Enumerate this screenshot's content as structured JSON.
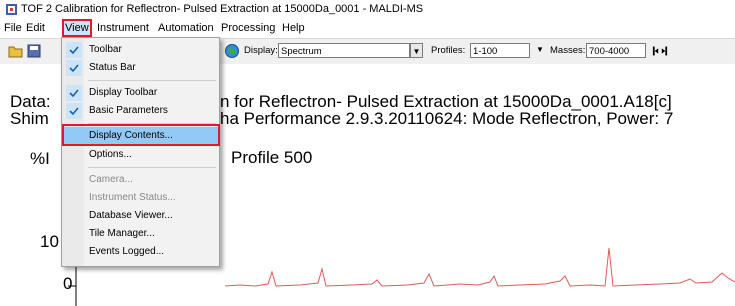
{
  "window": {
    "title": "TOF 2 Calibration for Reflectron- Pulsed Extraction at 15000Da_0001 - MALDI-MS"
  },
  "menubar": {
    "items": [
      "File",
      "Edit",
      "View",
      "Instrument",
      "Automation",
      "Processing",
      "Help"
    ],
    "open": "View"
  },
  "toolbar": {
    "display_label": "Display:",
    "display_value": "Spectrum",
    "profiles_label": "Profiles:",
    "profiles_value": "1-100",
    "masses_label": "Masses:",
    "masses_value": "700-4000"
  },
  "content": {
    "data_line1": "Data:",
    "data_line1_rest": "n for Reflectron- Pulsed Extraction at 15000Da_0001.A18[c]",
    "data_line2": "Shim",
    "data_line2_rest": "ha Performance 2.9.3.20110624: Mode Reflectron, Power: 7",
    "y_label": "%I",
    "profile_label": "Profile 500",
    "y_tick_top": "10",
    "y_tick_bottom": "0"
  },
  "view_menu": {
    "items": [
      {
        "label": "Toolbar",
        "checked": true,
        "enabled": true
      },
      {
        "label": "Status Bar",
        "checked": true,
        "enabled": true
      },
      {
        "label": "Display Toolbar",
        "checked": true,
        "enabled": true
      },
      {
        "label": "Basic Parameters",
        "checked": true,
        "enabled": true
      },
      {
        "label": "Display Contents...",
        "checked": false,
        "enabled": true,
        "highlighted": true
      },
      {
        "label": "Options...",
        "checked": false,
        "enabled": true
      },
      {
        "label": "Camera...",
        "checked": false,
        "enabled": false
      },
      {
        "label": "Instrument Status...",
        "checked": false,
        "enabled": false
      },
      {
        "label": "Database Viewer...",
        "checked": false,
        "enabled": true
      },
      {
        "label": "Tile Manager...",
        "checked": false,
        "enabled": true
      },
      {
        "label": "Events Logged...",
        "checked": false,
        "enabled": true
      }
    ]
  },
  "colors": {
    "highlight_box": "#e01a2a",
    "spectrum_trace": "#e05a5a",
    "menu_highlight": "#91c9f7"
  }
}
